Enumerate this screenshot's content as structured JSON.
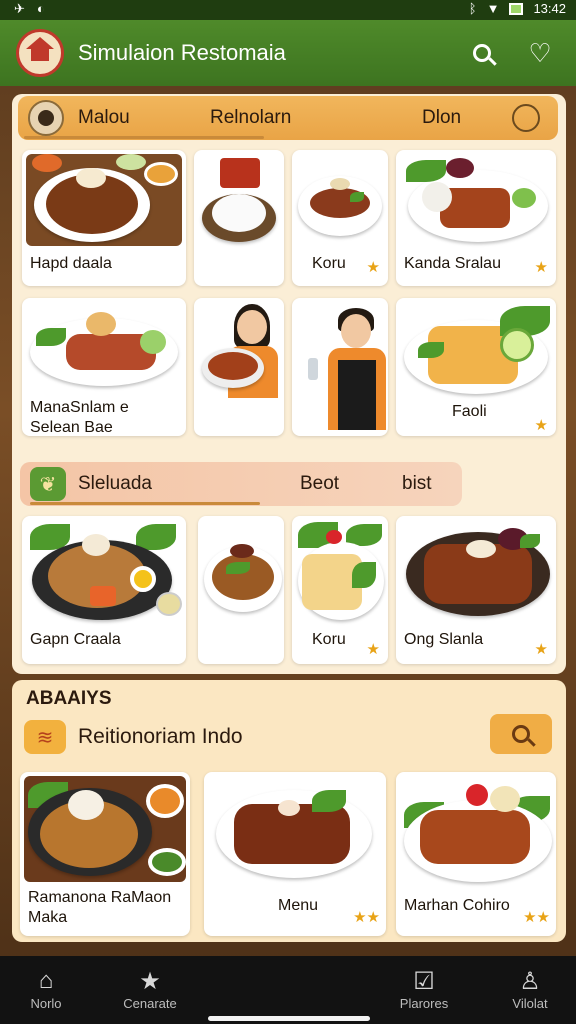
{
  "status_bar": {
    "time": "13:42",
    "left_icons": [
      "signal-icon",
      "sync-icon"
    ],
    "right_icons": [
      "bluetooth-icon",
      "wifi-icon",
      "battery-icon"
    ]
  },
  "app_bar": {
    "title": "Simulaion Restomaia",
    "icons": [
      "search-icon",
      "heart-icon"
    ]
  },
  "top_tabs": {
    "items": [
      "Malou",
      "Relnolarn",
      "Dlon"
    ]
  },
  "grid1": [
    {
      "label": "Hapd daala",
      "star": false
    },
    {
      "label": "",
      "star": false
    },
    {
      "label": "Koru",
      "star": true
    },
    {
      "label": "Kanda Sralau",
      "star": true
    },
    {
      "label": "ManaSnlam e Selean Bae",
      "star": false
    },
    {
      "label": "",
      "star": false
    },
    {
      "label": "",
      "star": false
    },
    {
      "label": "Faoli",
      "star": true
    }
  ],
  "section2": {
    "title": "Sleluada",
    "tabs": [
      "Beot",
      "bist"
    ]
  },
  "grid2": [
    {
      "label": "Gapn Craala",
      "star": false
    },
    {
      "label": "",
      "star": false
    },
    {
      "label": "Koru",
      "star": true
    },
    {
      "label": "Ong Slanla",
      "star": true
    }
  ],
  "section3": {
    "heading": "ABAAIYS",
    "title": "Reitionoriam Indo"
  },
  "grid3": [
    {
      "label": "Ramanona RaMaon Maka",
      "stars": 0
    },
    {
      "label": "Menu",
      "stars": 2
    },
    {
      "label": "Marhan Cohiro",
      "stars": 2
    }
  ],
  "bottom_nav": [
    {
      "label": "Norlo",
      "icon": "home-icon"
    },
    {
      "label": "Cenarate",
      "icon": "star-icon"
    },
    {
      "label": "Plarores",
      "icon": "check-icon"
    },
    {
      "label": "Vilolat",
      "icon": "person-icon"
    }
  ],
  "colors": {
    "app_bar": "#3d7420",
    "accent": "#e8a317",
    "panel": "#fbeed6",
    "tab_bar": "#e9a446"
  }
}
